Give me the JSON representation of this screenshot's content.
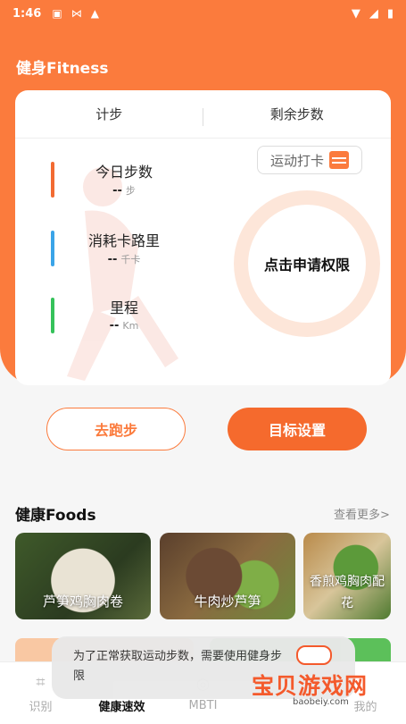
{
  "status_bar": {
    "time": "1:46"
  },
  "app": {
    "title": "健身Fitness"
  },
  "tabs": [
    "计步",
    "剩余步数"
  ],
  "stats": [
    {
      "label": "今日步数",
      "value": "--",
      "unit": "步",
      "color": "#f26b32"
    },
    {
      "label": "消耗卡路里",
      "value": "--",
      "unit": "千卡",
      "color": "#3aa4e8"
    },
    {
      "label": "里程",
      "value": "--",
      "unit": "Km",
      "color": "#35c25a"
    }
  ],
  "checkin": {
    "label": "运动打卡",
    "icon": "calendar-icon"
  },
  "permission": {
    "label": "点击申请权限"
  },
  "actions": {
    "run": "去跑步",
    "goal": "目标设置"
  },
  "foods_section": {
    "title": "健康Foods",
    "more": "查看更多>"
  },
  "foods": [
    {
      "name": "芦笋鸡胸肉卷"
    },
    {
      "name": "牛肉炒芦笋"
    },
    {
      "name": "香煎鸡胸肉配西兰花",
      "display": "香煎鸡胸肉配 花"
    }
  ],
  "toast": {
    "text": "为了正常获取运动步数，需要使用健身步数权限",
    "display_line1": "为了正常获取运动步数，需要使用健身步",
    "display_line2": "限"
  },
  "nav": [
    {
      "label": "识别",
      "icon": "scan-icon"
    },
    {
      "label": "健康速效",
      "icon": ""
    },
    {
      "label": "MBTI",
      "icon": "location-icon"
    },
    {
      "label": "",
      "icon": ""
    },
    {
      "label": "我的",
      "icon": ""
    }
  ],
  "watermark": {
    "text": "宝贝游戏网",
    "url": "baobeiy.com"
  },
  "colors": {
    "accent": "#fb7b3d",
    "accent_dark": "#f56a2d",
    "card_bg": "#ffffff"
  }
}
